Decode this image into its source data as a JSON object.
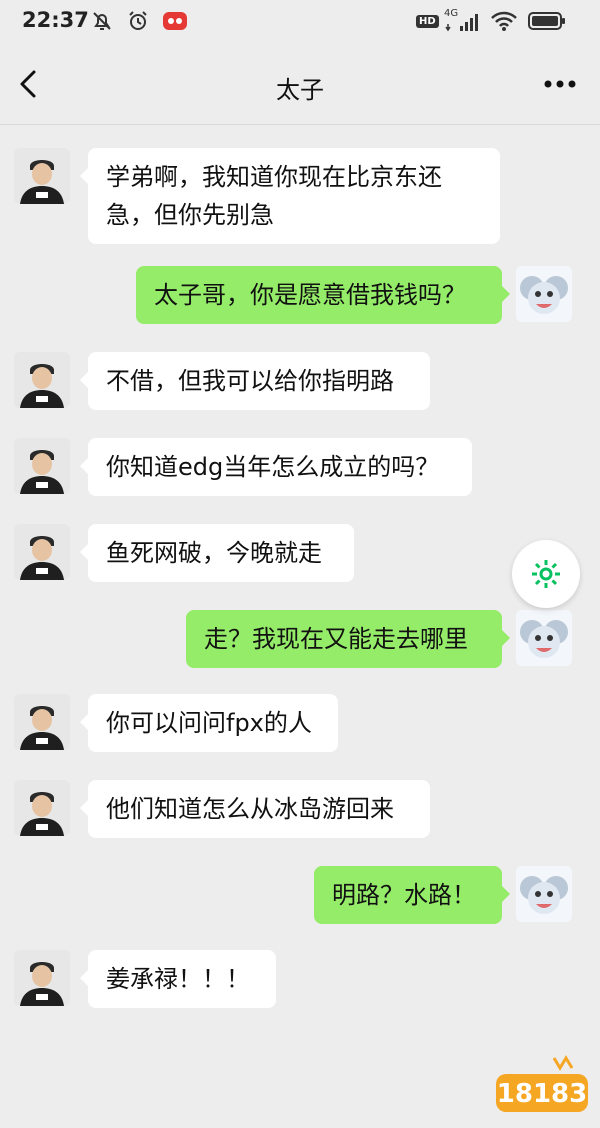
{
  "status_bar": {
    "time": "22:37",
    "network_type": "4G",
    "hd_label": "HD",
    "left_icons": [
      "mute-notification-icon",
      "alarm-icon",
      "app-notification-icon"
    ],
    "right_icons": [
      "hd-voice-icon",
      "signal-icon",
      "wifi-icon",
      "battery-icon"
    ]
  },
  "header": {
    "title": "太子",
    "back_icon": "chevron-left-icon",
    "more_icon": "more-dots-icon"
  },
  "messages": [
    {
      "side": "in",
      "text": "学弟啊，我知道你现在比京东还急，但你先别急"
    },
    {
      "side": "out",
      "text": "太子哥，你是愿意借我钱吗？"
    },
    {
      "side": "in",
      "text": "不借，但我可以给你指明路"
    },
    {
      "side": "in",
      "text": "你知道edg当年怎么成立的吗？"
    },
    {
      "side": "in",
      "text": "鱼死网破，今晚就走"
    },
    {
      "side": "out",
      "text": "走？我现在又能走去哪里"
    },
    {
      "side": "in",
      "text": "你可以问问fpx的人"
    },
    {
      "side": "in",
      "text": "他们知道怎么从冰岛游回来"
    },
    {
      "side": "out",
      "text": "明路？水路！"
    },
    {
      "side": "in",
      "text": "姜承禄！！！"
    }
  ],
  "floating_button": {
    "icon": "gear-icon"
  },
  "watermark": {
    "text": "18183"
  },
  "colors": {
    "background": "#ededed",
    "incoming_bubble": "#ffffff",
    "outgoing_bubble": "#95ec69",
    "accent": "#07c160"
  }
}
